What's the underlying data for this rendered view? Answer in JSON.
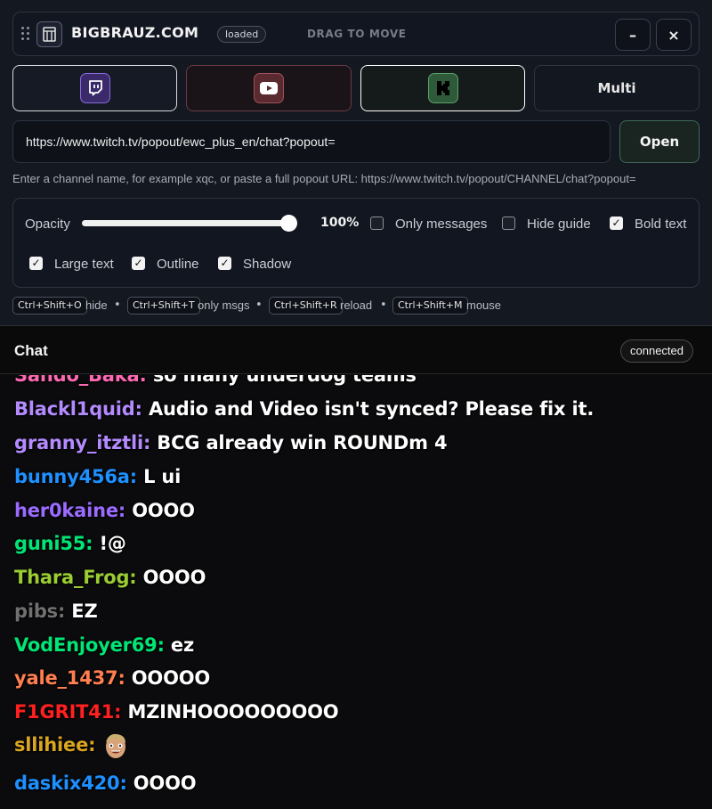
{
  "header": {
    "brand": "BIGBRAUZ.COM",
    "status_badge": "loaded",
    "drag_label": "DRAG TO MOVE",
    "minimize_label": "–",
    "close_label": "×"
  },
  "platforms": [
    {
      "name": "twitch",
      "icon": "twitch-icon",
      "color": "#9146ff"
    },
    {
      "name": "youtube",
      "icon": "youtube-icon",
      "color": "#ff0000"
    },
    {
      "name": "kick",
      "icon": "kick-icon",
      "color": "#53fc18"
    },
    {
      "name": "multi",
      "label": "Multi"
    }
  ],
  "url_input": {
    "value": "https://www.twitch.tv/popout/ewc_plus_en/chat?popout=",
    "open_label": "Open",
    "hint": "Enter a channel name, for example xqc, or paste a full popout URL: https://www.twitch.tv/popout/CHANNEL/chat?popout="
  },
  "options": {
    "opacity_label": "Opacity",
    "opacity_value": "100%",
    "opacity_level": 1.0,
    "checkboxes": [
      {
        "label": "Only messages",
        "checked": false
      },
      {
        "label": "Hide guide",
        "checked": false
      },
      {
        "label": "Bold text",
        "checked": true
      },
      {
        "label": "Large text",
        "checked": true
      },
      {
        "label": "Outline",
        "checked": true
      },
      {
        "label": "Shadow",
        "checked": true
      }
    ]
  },
  "shortcuts": [
    {
      "keys": "Ctrl+Shift+O",
      "desc": "hide"
    },
    {
      "keys": "Ctrl+Shift+T",
      "desc": "only msgs"
    },
    {
      "keys": "Ctrl+Shift+R",
      "desc": "reload"
    },
    {
      "keys": "Ctrl+Shift+M",
      "desc": "mouse"
    }
  ],
  "chat": {
    "title": "Chat",
    "status": "connected",
    "messages": [
      {
        "user": "Sando_Baka:",
        "text": "so many underdog teams",
        "color": "#ff69b4"
      },
      {
        "user": "Blackl1quid:",
        "text": "Audio and Video isn't synced? Please fix it.",
        "color": "#b48bff"
      },
      {
        "user": "granny_itztli:",
        "text": "BCG already win ROUNDm 4",
        "color": "#b48bff"
      },
      {
        "user": "bunny456a:",
        "text": "L ui",
        "color": "#1e90ff"
      },
      {
        "user": "her0kaine:",
        "text": "OOOO",
        "color": "#9b6bff"
      },
      {
        "user": "guni55:",
        "text": "!@",
        "color": "#00e676"
      },
      {
        "user": "Thara_Frog:",
        "text": "OOOO",
        "color": "#9acd32"
      },
      {
        "user": "pibs:",
        "text": "EZ",
        "color": "#707070"
      },
      {
        "user": "VodEnjoyer69:",
        "text": "ez",
        "color": "#00e676"
      },
      {
        "user": "yale_1437:",
        "text": "OOOOO",
        "color": "#ff7f50"
      },
      {
        "user": "F1GRIT41:",
        "text": "MZINHOOOOOOOOO",
        "color": "#ff2020"
      },
      {
        "user": "sllihiee:",
        "text": "",
        "emote": "face-emote",
        "color": "#daa520"
      },
      {
        "user": "daskix420:",
        "text": "OOOO",
        "color": "#1e90ff"
      }
    ]
  }
}
